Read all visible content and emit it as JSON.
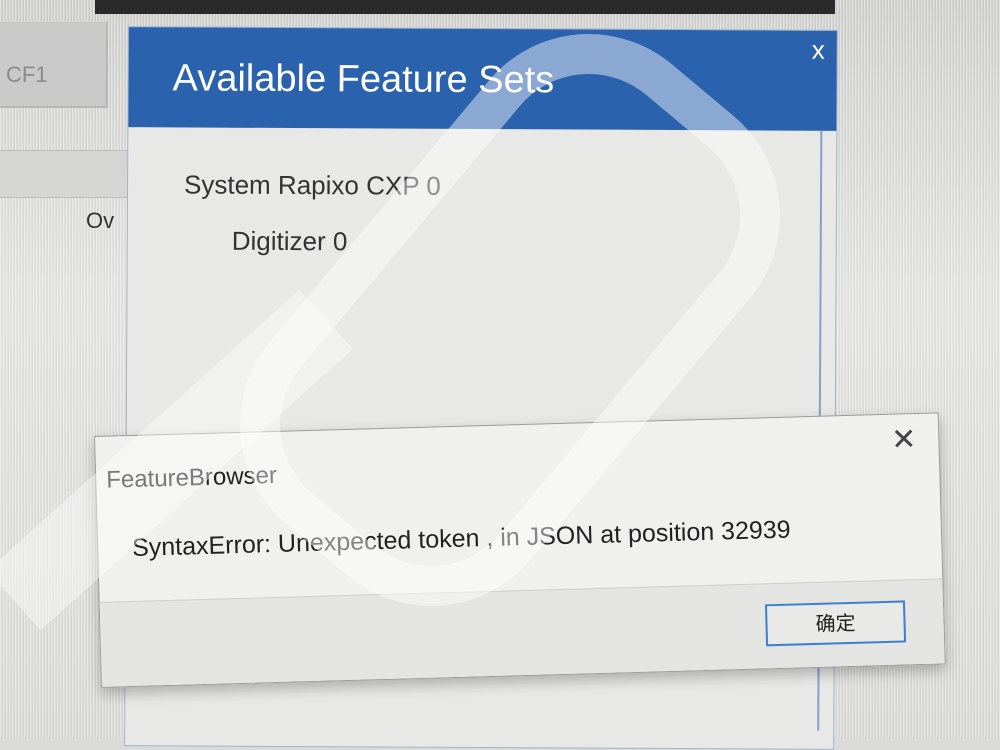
{
  "background_app": {
    "tab_text": "CF1",
    "label": "Ov"
  },
  "feature_panel": {
    "title": "Available Feature Sets",
    "close_glyph": "x",
    "lines": [
      "System Rapixo CXP 0",
      "Digitizer 0"
    ],
    "header_color": "#2a62ad"
  },
  "error_dialog": {
    "title": "FeatureBrowser",
    "close_glyph": "✕",
    "message": "SyntaxError: Unexpected token , in JSON at position 32939",
    "ok_label": "确定",
    "ok_border_color": "#3c7fd0"
  }
}
